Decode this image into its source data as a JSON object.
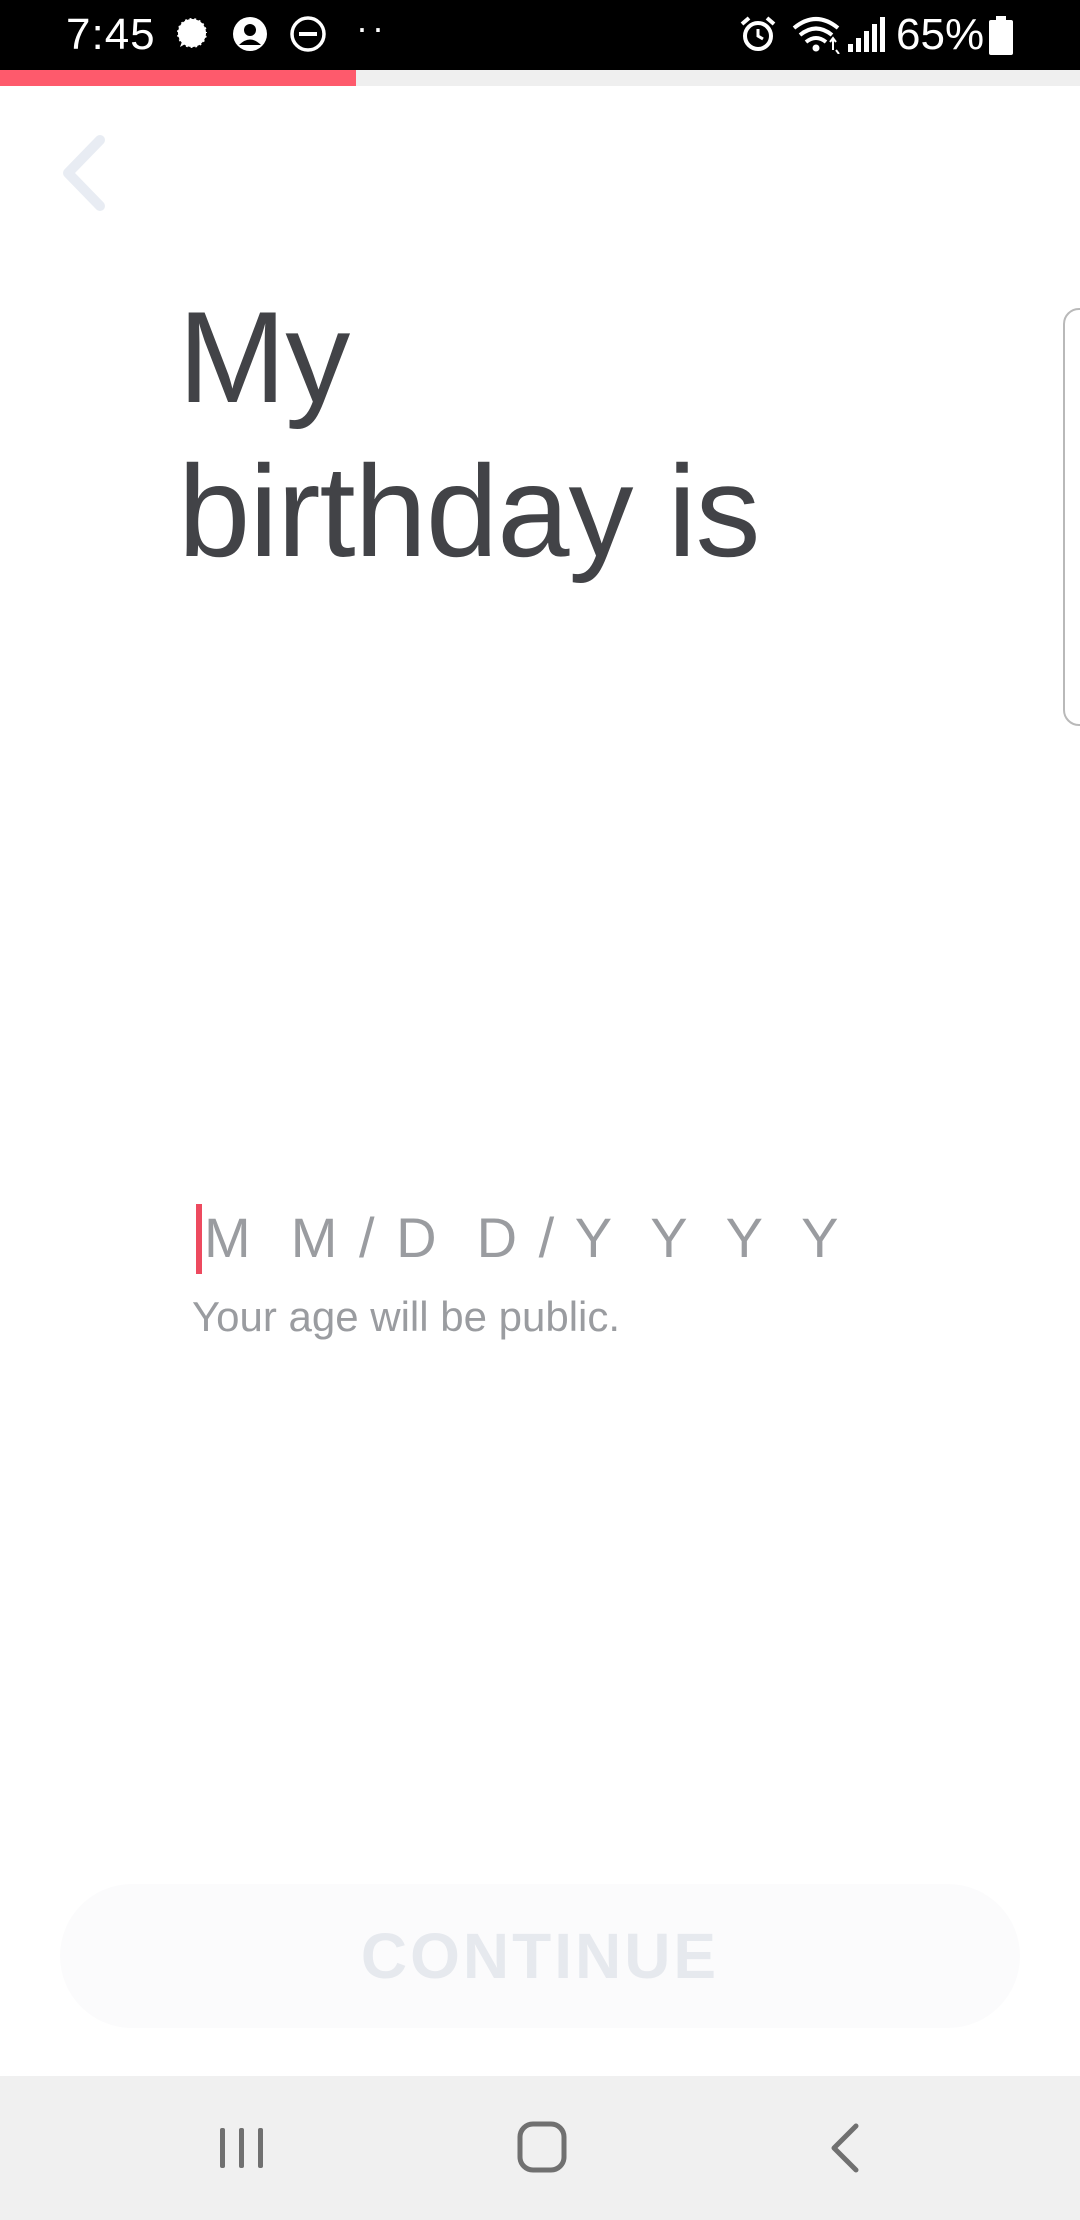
{
  "status_bar": {
    "time": "7:45",
    "battery_percent": "65%",
    "overflow_dots": "··",
    "icons": [
      "signal-chat-icon",
      "account-circle-icon",
      "do-not-disturb-icon",
      "alarm-icon",
      "wifi-icon",
      "cell-signal-icon",
      "battery-icon"
    ]
  },
  "progress": {
    "fraction": 0.33,
    "color": "#fe5a6c"
  },
  "header": {
    "back_icon": "chevron-left-icon"
  },
  "title": {
    "line1": "My",
    "line2": "birthday is"
  },
  "birthday_input": {
    "placeholder": "M  M / D  D / Y  Y  Y  Y",
    "hint": "Your age will be public."
  },
  "continue_button": {
    "label": "CONTINUE",
    "enabled": false
  },
  "nav_bar": {
    "icons": [
      "recent-apps-icon",
      "home-icon",
      "back-icon"
    ]
  },
  "colors": {
    "accent": "#fe5a6c",
    "caret": "#ed4a5f",
    "title_text": "#424347",
    "hint_text": "#9a9ca0",
    "disabled_button_text": "#e6e9ee"
  }
}
